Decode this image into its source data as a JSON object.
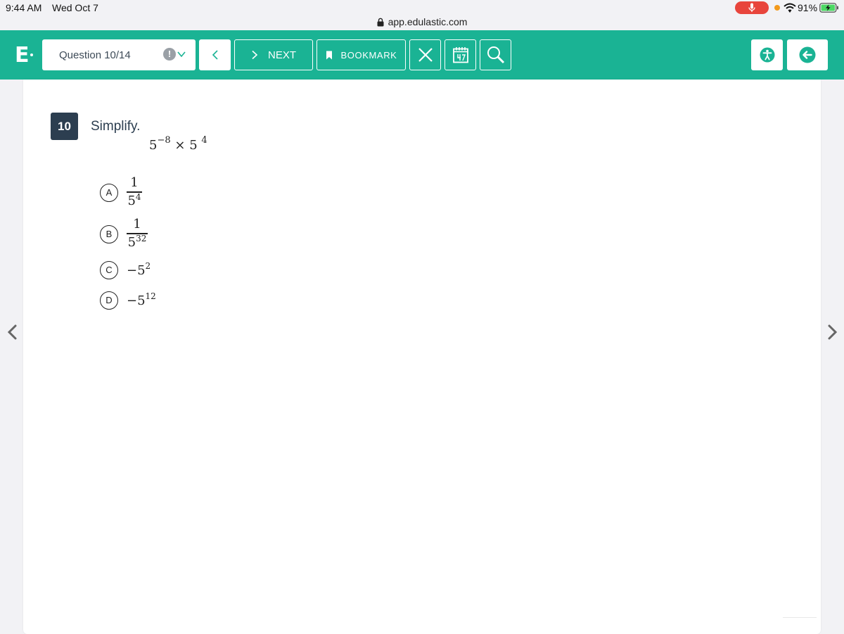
{
  "status_bar": {
    "time": "9:44 AM",
    "date": "Wed Oct 7",
    "battery": "91%"
  },
  "browser": {
    "url": "app.edulastic.com"
  },
  "toolbar": {
    "logo": "E",
    "question_selector": "Question 10/14",
    "alert_glyph": "!",
    "next_label": "NEXT",
    "bookmark_label": "BOOKMARK",
    "accent_color": "#1ab394"
  },
  "question": {
    "number": "10",
    "prompt": "Simplify.",
    "expression": {
      "base1": "5",
      "exp1": "−8",
      "op": "×",
      "base2": "5",
      "exp2": "4"
    },
    "options": [
      {
        "letter": "A",
        "numerator": "1",
        "base": "5",
        "exp": "4"
      },
      {
        "letter": "B",
        "numerator": "1",
        "base": "5",
        "exp": "32"
      },
      {
        "letter": "C",
        "sign": "−",
        "base": "5",
        "exp": "2"
      },
      {
        "letter": "D",
        "sign": "−",
        "base": "5",
        "exp": "12"
      }
    ]
  }
}
